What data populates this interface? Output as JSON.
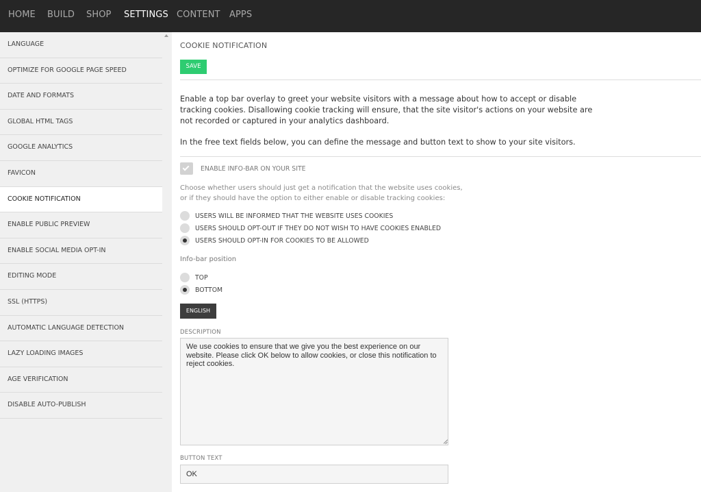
{
  "topnav": {
    "items": [
      {
        "label": "HOME",
        "active": false
      },
      {
        "label": "BUILD",
        "active": false
      },
      {
        "label": "SHOP",
        "active": false
      },
      {
        "label": "SETTINGS",
        "active": true
      },
      {
        "label": "CONTENT",
        "active": false
      },
      {
        "label": "APPS",
        "active": false
      }
    ]
  },
  "sidebar": {
    "items": [
      {
        "label": "LANGUAGE"
      },
      {
        "label": "OPTIMIZE FOR GOOGLE PAGE SPEED"
      },
      {
        "label": "DATE AND FORMATS"
      },
      {
        "label": "GLOBAL HTML TAGS"
      },
      {
        "label": "GOOGLE ANALYTICS"
      },
      {
        "label": "FAVICON"
      },
      {
        "label": "COOKIE NOTIFICATION",
        "active": true
      },
      {
        "label": "ENABLE PUBLIC PREVIEW"
      },
      {
        "label": "ENABLE SOCIAL MEDIA OPT-IN"
      },
      {
        "label": "EDITING MODE"
      },
      {
        "label": "SSL (HTTPS)"
      },
      {
        "label": "AUTOMATIC LANGUAGE DETECTION"
      },
      {
        "label": "LAZY LOADING IMAGES"
      },
      {
        "label": "AGE VERIFICATION"
      },
      {
        "label": "DISABLE AUTO-PUBLISH"
      }
    ]
  },
  "main": {
    "title": "COOKIE NOTIFICATION",
    "save_label": "SAVE",
    "description": "Enable a top bar overlay to greet your website visitors with a message about how to accept or disable tracking cookies. Disallowing cookie tracking will ensure, that the site visitor's actions on your website are not recorded or captured in your analytics dashboard.",
    "description2": "In the free text fields below, you can define the message and button text to show to your site visitors.",
    "enable_label": "ENABLE INFO-BAR ON YOUR SITE",
    "enable_checked": true,
    "choose_text": "Choose whether users should just get a notification that the website uses cookies, or if they should have the option to either enable or disable tracking cookies:",
    "mode_options": [
      {
        "label": "USERS WILL BE INFORMED THAT THE WEBSITE USES COOKIES",
        "checked": false
      },
      {
        "label": "USERS SHOULD OPT-OUT IF THEY DO NOT WISH TO HAVE COOKIES ENABLED",
        "checked": false
      },
      {
        "label": "USERS SHOULD OPT-IN FOR COOKIES TO BE ALLOWED",
        "checked": true
      }
    ],
    "position_label": "Info-bar position",
    "position_options": [
      {
        "label": "TOP",
        "checked": false
      },
      {
        "label": "BOTTOM",
        "checked": true
      }
    ],
    "language_button": "ENGLISH",
    "description_label": "DESCRIPTION",
    "description_value": "We use cookies to ensure that we give you the best experience on our website. Please click OK below to allow cookies, or close this notification to reject cookies.",
    "button_text_label": "BUTTON TEXT",
    "button_text_value": "OK"
  }
}
